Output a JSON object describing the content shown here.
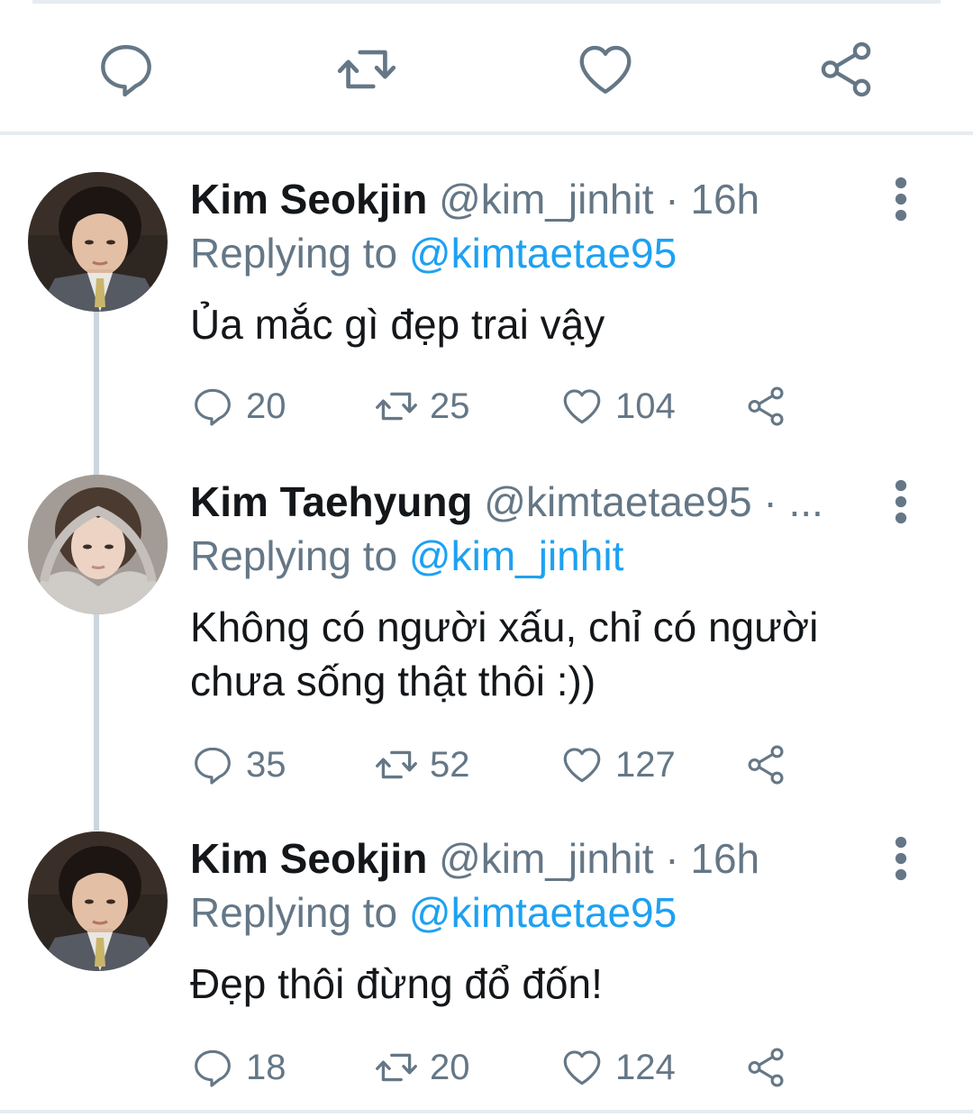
{
  "top_actions": {
    "icons": [
      "reply-icon",
      "retweet-icon",
      "like-icon",
      "share-icon"
    ],
    "color": "#657786"
  },
  "colors": {
    "accent": "#1da1f2",
    "secondary_text": "#657786",
    "primary_text": "#14171a",
    "divider": "#e6ecf0",
    "thread_line": "#ccd6dd"
  },
  "tweets": [
    {
      "name": "Kim Seokjin",
      "handle": "@kim_jinhit",
      "time_sep": " · 16h",
      "replying_prefix": "Replying to ",
      "replying_to": "@kimtaetae95",
      "text_lines": [
        "Ủa mắc gì đẹp trai vậy"
      ],
      "replies": "20",
      "retweets": "25",
      "likes": "104"
    },
    {
      "name": "Kim Taehyung",
      "handle": "@kimtaetae95",
      "time_sep": " · ...",
      "replying_prefix": "Replying to ",
      "replying_to": "@kim_jinhit",
      "text_lines": [
        "Không có người xấu, chỉ có người",
        "chưa sống thật thôi :))"
      ],
      "replies": "35",
      "retweets": "52",
      "likes": "127"
    },
    {
      "name": "Kim Seokjin",
      "handle": "@kim_jinhit",
      "time_sep": " · 16h",
      "replying_prefix": "Replying to ",
      "replying_to": "@kimtaetae95",
      "text_lines": [
        "Đẹp thôi đừng đổ đốn!"
      ],
      "replies": "18",
      "retweets": "20",
      "likes": "124"
    }
  ]
}
